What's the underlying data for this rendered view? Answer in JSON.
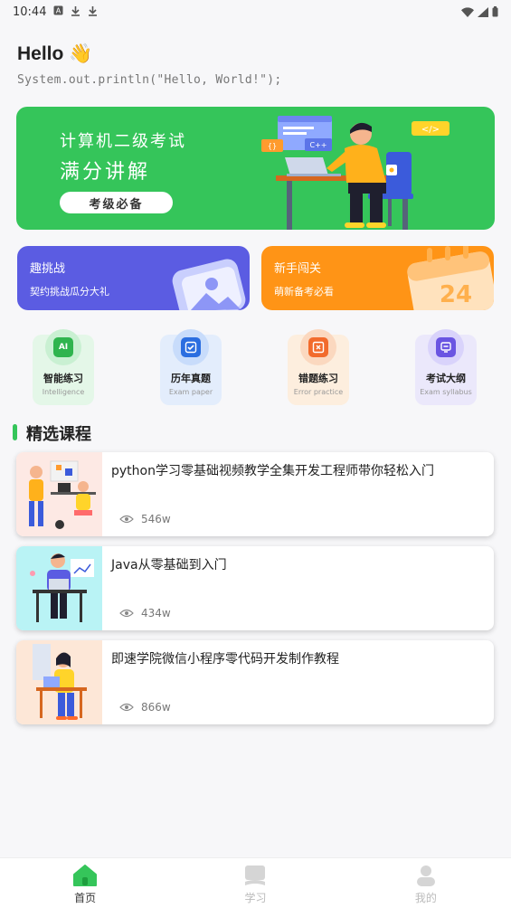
{
  "status_bar": {
    "time": "10:44"
  },
  "header": {
    "greeting": "Hello 👋",
    "code_line": "System.out.println(\"Hello, World!\");"
  },
  "banner": {
    "line1": "计算机二级考试",
    "line2": "满分讲解",
    "button_label": "考级必备",
    "color": "#35c55a"
  },
  "promos": [
    {
      "title": "趣挑战",
      "subtitle": "契约挑战瓜分大礼",
      "color": "#5b5ce2"
    },
    {
      "title": "新手闯关",
      "subtitle": "萌新备考必看",
      "color": "#ff9416"
    }
  ],
  "tiles": [
    {
      "label": "智能练习",
      "sub": "Intelligence",
      "icon": "ai-chip-icon",
      "bg": "#e4f7e8",
      "accent": "#2fb44e"
    },
    {
      "label": "历年真题",
      "sub": "Exam paper",
      "icon": "checklist-icon",
      "bg": "#e3edfc",
      "accent": "#2b6ee0"
    },
    {
      "label": "错题练习",
      "sub": "Error practice",
      "icon": "error-book-icon",
      "bg": "#fdeede",
      "accent": "#f26b2c"
    },
    {
      "label": "考试大纲",
      "sub": "Exam syllabus",
      "icon": "syllabus-icon",
      "bg": "#ebe8fb",
      "accent": "#6a55e2"
    }
  ],
  "section": {
    "title": "精选课程"
  },
  "courses": [
    {
      "title": "python学习零基础视频教学全集开发工程师带你轻松入门",
      "views": "546w"
    },
    {
      "title": "Java从零基础到入门",
      "views": "434w"
    },
    {
      "title": "即速学院微信小程序零代码开发制作教程",
      "views": "866w"
    }
  ],
  "bottom_nav": [
    {
      "label": "首页",
      "icon": "home-icon",
      "active": true
    },
    {
      "label": "学习",
      "icon": "book-icon",
      "active": false
    },
    {
      "label": "我的",
      "icon": "profile-icon",
      "active": false
    }
  ]
}
